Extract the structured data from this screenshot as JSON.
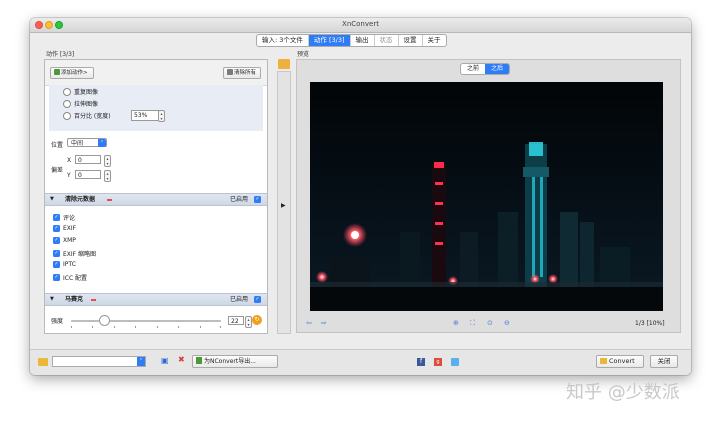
{
  "window": {
    "title": "XnConvert"
  },
  "tabs": [
    {
      "label": "输入: 3个文件",
      "state": "normal"
    },
    {
      "label": "动作 [3/3]",
      "state": "active"
    },
    {
      "label": "输出",
      "state": "normal"
    },
    {
      "label": "状态",
      "state": "disabled"
    },
    {
      "label": "设置",
      "state": "normal"
    },
    {
      "label": "关于",
      "state": "normal"
    }
  ],
  "actions_panel": {
    "label": "动作 [3/3]",
    "add_action": "添加动作>",
    "clear_all": "清除所有",
    "resize_options": [
      {
        "label": "重复图像"
      },
      {
        "label": "拉伸图像"
      },
      {
        "label": "百分比 (宽度)",
        "value": "53%"
      }
    ],
    "position_label": "位置",
    "position_value": "中间",
    "offset_label": "偏差",
    "x_label": "X",
    "x_value": "0",
    "y_label": "Y",
    "y_value": "0",
    "groups": [
      {
        "title": "清除元数据",
        "enabled_label": "已启用",
        "enabled": true
      },
      {
        "title": "马赛克",
        "enabled_label": "已启用",
        "enabled": true
      }
    ],
    "metadata_items": [
      "评论",
      "EXIF",
      "XMP",
      "EXIF 缩略图",
      "IPTC",
      "ICC 配置"
    ],
    "strength_label": "强度",
    "strength_value": "22",
    "strength_fraction": 0.22
  },
  "preview": {
    "label": "预览",
    "before": "之前",
    "after": "之后",
    "page_info": "1/3 [10%]"
  },
  "bottom": {
    "export_label": "为NConvert导出...",
    "convert": "Convert",
    "close": "关闭"
  },
  "watermark": "知乎 @少数派",
  "colors": {
    "accent": "#2e7cf6",
    "minus_red": "#e05050",
    "traffic_red": "#fc5f57",
    "traffic_yellow": "#fdbd2e",
    "traffic_green": "#28c840"
  }
}
